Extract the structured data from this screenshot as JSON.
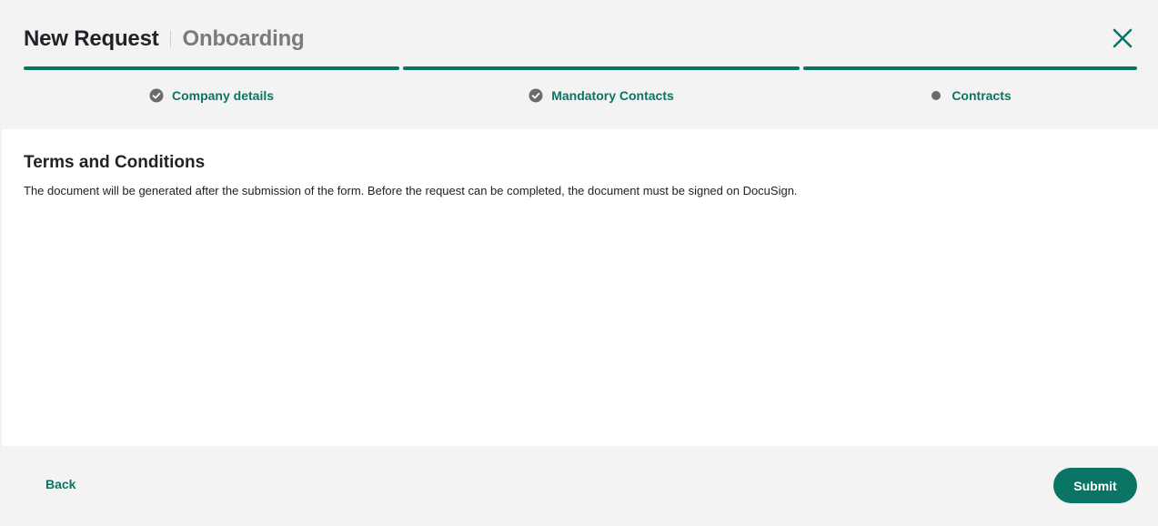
{
  "header": {
    "title": "New Request",
    "subtitle": "Onboarding",
    "close_icon": "close-icon"
  },
  "steps": [
    {
      "label": "Company details",
      "status": "completed",
      "icon": "check-circle-icon"
    },
    {
      "label": "Mandatory Contacts",
      "status": "completed",
      "icon": "check-circle-icon"
    },
    {
      "label": "Contracts",
      "status": "current",
      "icon": "dot-icon"
    }
  ],
  "content": {
    "section_title": "Terms and Conditions",
    "section_text": "The document will be generated after the submission of the form. Before the request can be completed, the document must be signed on DocuSign."
  },
  "footer": {
    "back_label": "Back",
    "submit_label": "Submit"
  },
  "colors": {
    "accent": "#0a7565",
    "header_bg": "#f3f3f3",
    "content_bg": "#ffffff",
    "muted_icon": "#6b6b6b"
  }
}
